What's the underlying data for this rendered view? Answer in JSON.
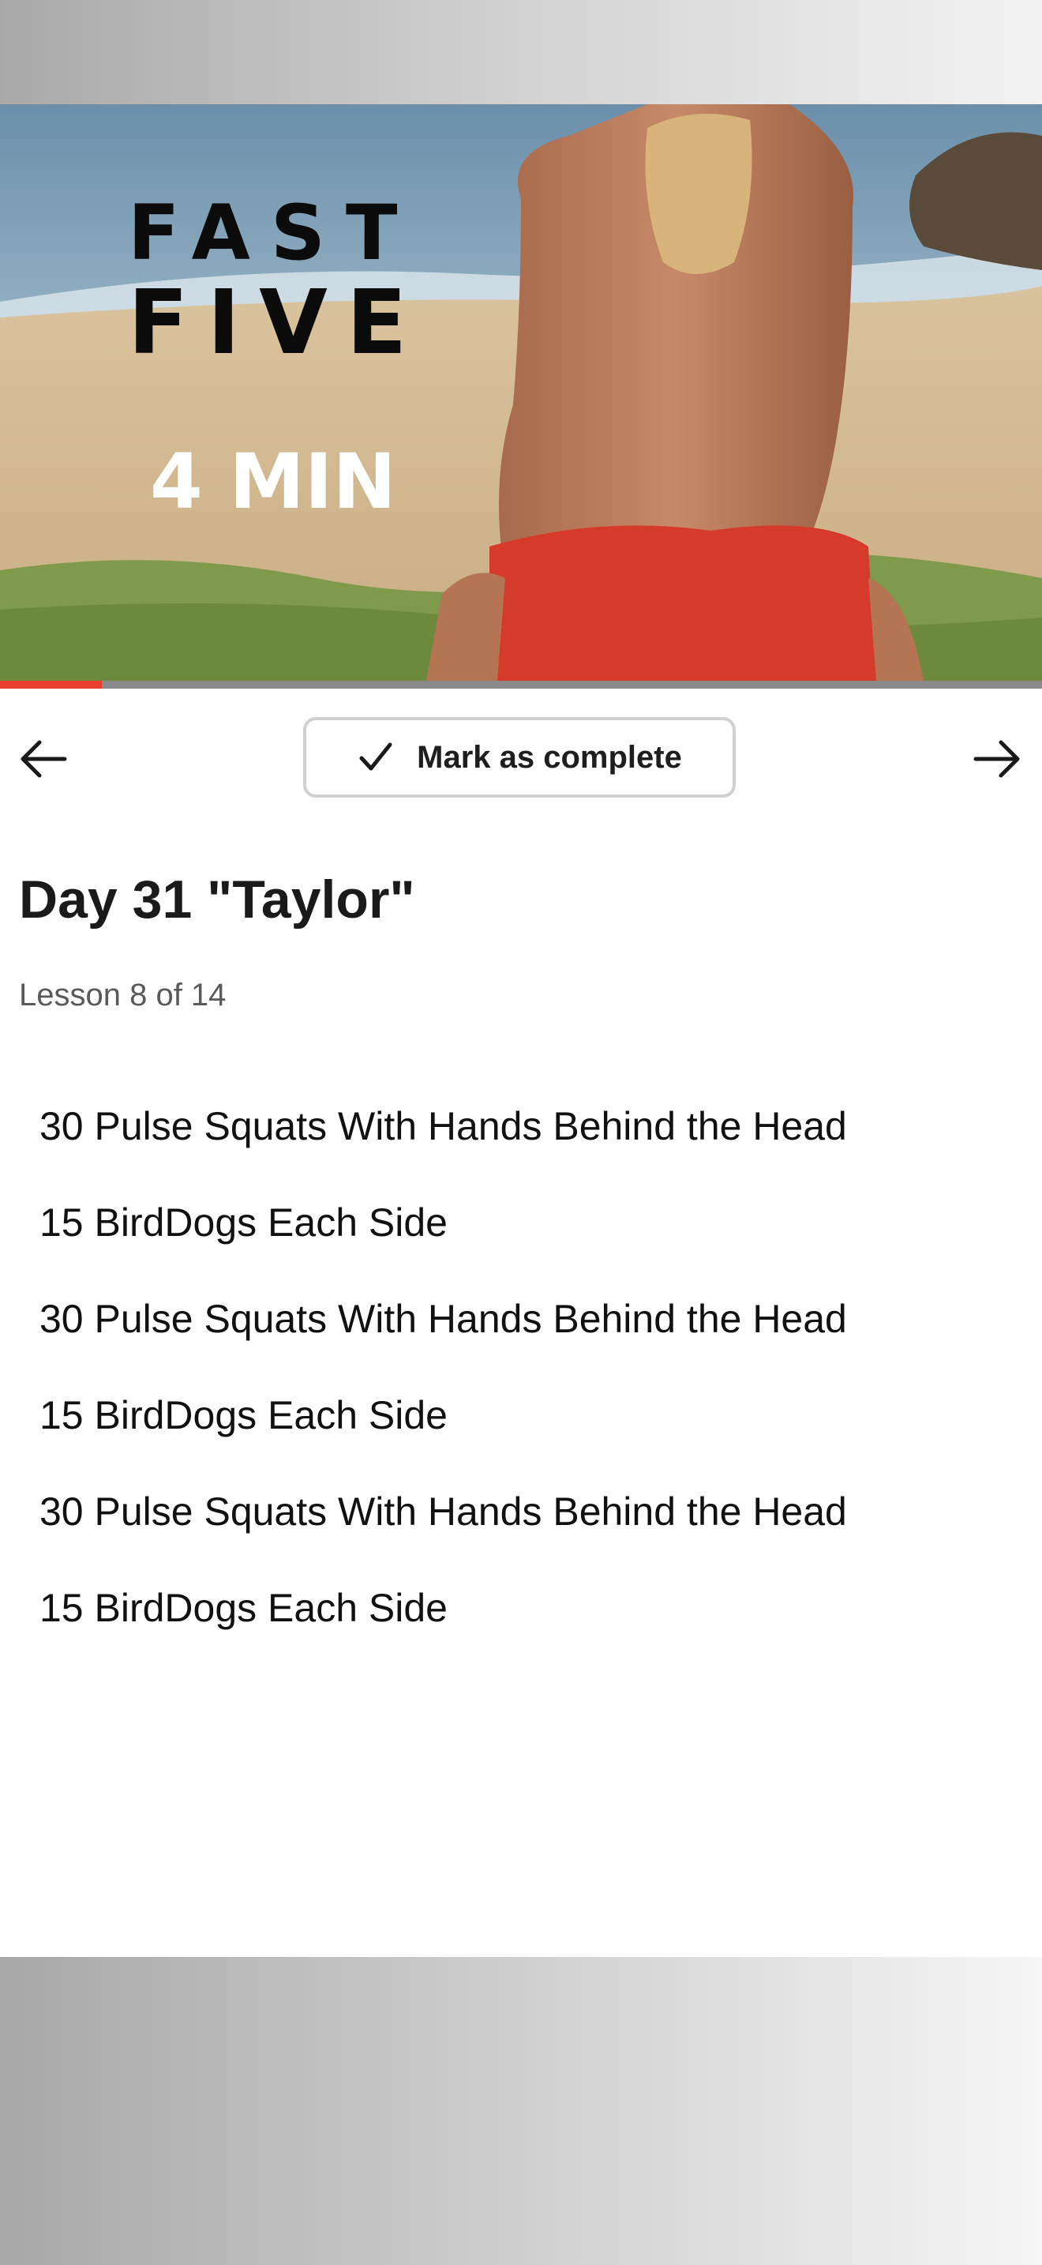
{
  "video": {
    "overlay_line1": "FAST",
    "overlay_line2": "FIVE",
    "duration_label": "4 MIN",
    "progress_fraction": 0.098,
    "accent_color": "#e8402f"
  },
  "nav": {
    "prev_icon": "arrow-left-icon",
    "next_icon": "arrow-right-icon"
  },
  "complete_button": {
    "icon": "checkmark-icon",
    "label": "Mark as complete"
  },
  "lesson": {
    "title": "Day 31 \"Taylor\"",
    "meta": "Lesson 8 of 14"
  },
  "exercises": [
    "30 Pulse Squats With Hands Behind the Head",
    "15 BirdDogs Each Side",
    "30 Pulse Squats With Hands Behind the Head",
    "15 BirdDogs Each Side",
    "30 Pulse Squats With Hands Behind the Head",
    "15 BirdDogs Each Side"
  ]
}
